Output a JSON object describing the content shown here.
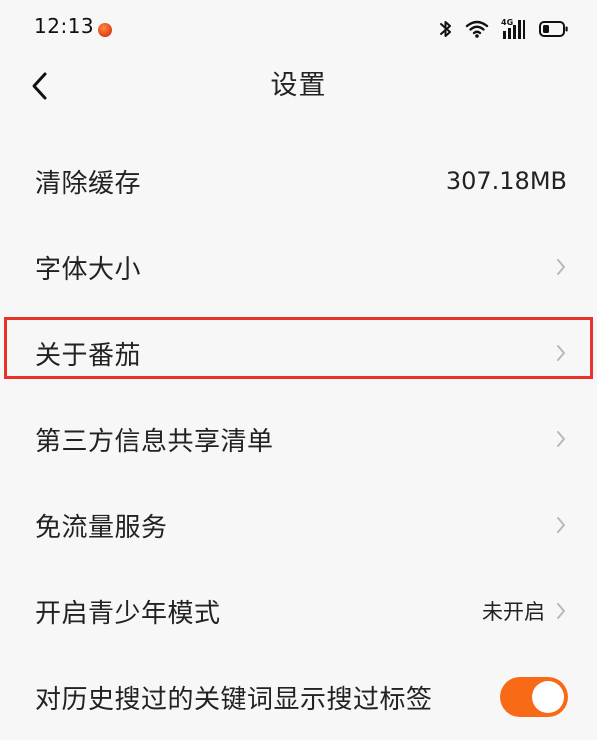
{
  "status_bar": {
    "time": "12:13",
    "network_label": "4G",
    "icons": [
      "app-notification-icon",
      "bluetooth-icon",
      "wifi-icon",
      "signal-icon",
      "battery-icon"
    ]
  },
  "header": {
    "title": "设置",
    "back_icon": "chevron-left-icon"
  },
  "settings": {
    "items": [
      {
        "label": "清除缓存",
        "value": "307.18MB"
      },
      {
        "label": "字体大小"
      },
      {
        "label": "关于番茄",
        "highlighted": true
      },
      {
        "label": "第三方信息共享清单"
      },
      {
        "label": "免流量服务"
      },
      {
        "label": "开启青少年模式",
        "value": "未开启"
      },
      {
        "label": "对历史搜过的关键词显示搜过标签",
        "toggle_on": true
      }
    ]
  },
  "colors": {
    "accent": "#f96a17",
    "highlight_border": "#e8322c",
    "background": "#f7f7f7",
    "chevron": "#b8b8b8"
  }
}
